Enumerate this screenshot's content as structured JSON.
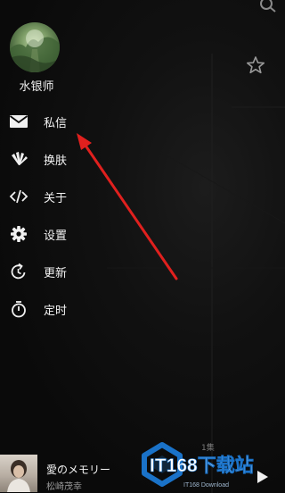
{
  "drawer": {
    "username": "水银师",
    "items": [
      {
        "label": "私信",
        "icon": "mail-icon"
      },
      {
        "label": "换肤",
        "icon": "skin-icon"
      },
      {
        "label": "关于",
        "icon": "code-icon"
      },
      {
        "label": "设置",
        "icon": "gear-icon"
      },
      {
        "label": "更新",
        "icon": "refresh-icon"
      },
      {
        "label": "定时",
        "icon": "timer-icon"
      }
    ]
  },
  "background": {
    "partial_text": "1集"
  },
  "player": {
    "song_title": "愛のメモリー",
    "artist": "松崎茂幸"
  },
  "watermark": {
    "brand": "IT168下载站",
    "sub": "IT168 Download"
  },
  "colors": {
    "background": "#0b0b0b",
    "annotation_arrow": "#e0201e",
    "watermark_blue": "#1a72c8"
  }
}
